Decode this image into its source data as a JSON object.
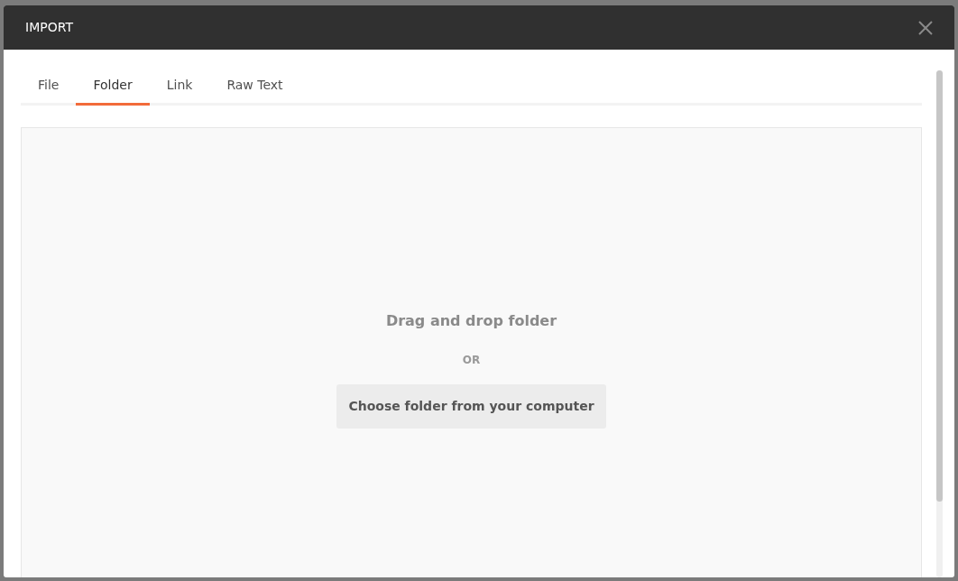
{
  "dialog": {
    "title": "IMPORT"
  },
  "tabs": [
    {
      "label": "File",
      "selected": false
    },
    {
      "label": "Folder",
      "selected": true
    },
    {
      "label": "Link",
      "selected": false
    },
    {
      "label": "Raw Text",
      "selected": false
    }
  ],
  "dropzone": {
    "heading": "Drag and drop folder",
    "separator": "OR",
    "button": "Choose folder from your computer"
  }
}
